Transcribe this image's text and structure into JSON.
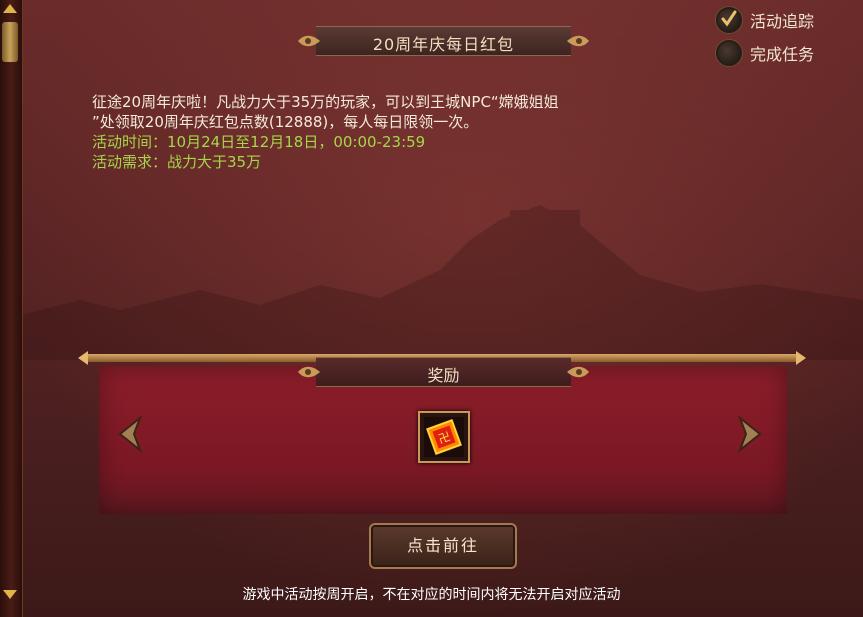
{
  "title": "20周年庆每日红包",
  "options": {
    "track": {
      "label": "活动追踪",
      "checked": true
    },
    "complete": {
      "label": "完成任务",
      "checked": false
    }
  },
  "description": {
    "line1": "征途20周年庆啦！凡战力大于35万的玩家，可以到王城NPC“嫦娥姐姐",
    "line2": "”处领取20周年庆红包点数(12888)，每人每日限领一次。",
    "time": "活动时间：10月24日至12月18日，00:00-23:59",
    "requirement": "活动需求：战力大于35万"
  },
  "reward": {
    "title": "奖励",
    "item_icon": "red-envelope-icon"
  },
  "buttons": {
    "go": "点击前往"
  },
  "footer": "游戏中活动按周开启，不在对应的时间内将无法开启对应活动",
  "colors": {
    "highlight_text": "#a6d64a",
    "panel": "#8c1e2a"
  }
}
